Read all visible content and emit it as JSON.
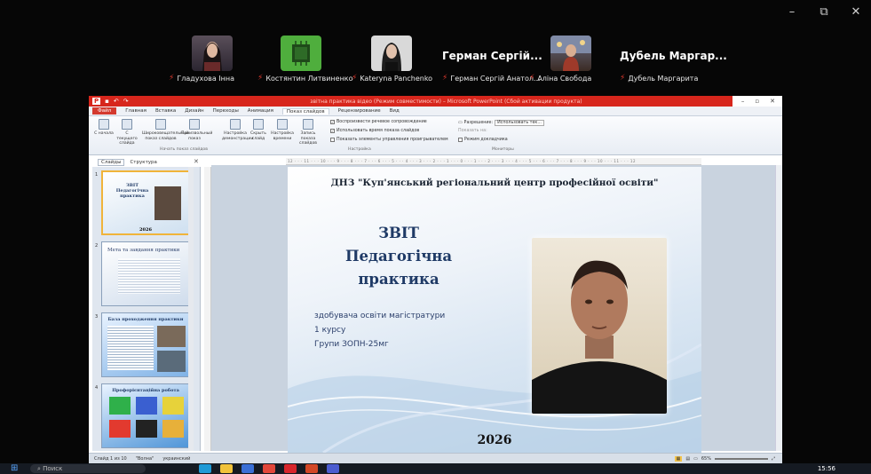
{
  "window_controls": {
    "minimize": "–",
    "restore": "⧉",
    "close": "✕"
  },
  "participants": [
    {
      "label": "Гладухова Інна",
      "thumb_color": "#3c3a45"
    },
    {
      "label": "Костянтин Литвиненко",
      "thumb_color": "#4fae3d"
    },
    {
      "label": "Kateryna Panchenko",
      "thumb_color": "#cdcdcd"
    },
    {
      "big_name": "Герман Сергій...",
      "label": "Герман Сергій Анатол..."
    },
    {
      "label": "Аліна Свобода",
      "thumb_color": "#8b5a3c"
    },
    {
      "big_name": "Дубель Маргар...",
      "label": "Дубель Маргарита"
    }
  ],
  "ppt": {
    "title": "звітна практика відео (Режим совместимости) – Microsoft PowerPoint (Сбой активации продукта)",
    "menu": [
      "Файл",
      "Главная",
      "Вставка",
      "Дизайн",
      "Переходы",
      "Анимация",
      "Показ слайдов",
      "Рецензирование",
      "Вид"
    ],
    "active_menu": "Показ слайдов",
    "ribbon_buttons": [
      "С начала",
      "С текущего слайда",
      "Широковещательный показ слайдов",
      "Произвольный показ",
      "Настройка демонстрации",
      "Скрыть слайд",
      "Настройка времени",
      "Запись показа слайдов"
    ],
    "ribbon_groups": [
      "Начать показ слайдов",
      "Настройка",
      "Мониторы"
    ],
    "checks": [
      "Воспроизвести речевое сопровождение",
      "Использовать время показа слайдов",
      "Показать элементы управления проигрывателем"
    ],
    "resolution_label": "Разрешение:",
    "resolution_value": "Использовать тек...",
    "show_on_label": "Показать на:",
    "presenter_view": "Режим докладчика",
    "pane_tabs": [
      "Слайды",
      "Структура"
    ],
    "ruler_text": "12 · · · 11 · · · 10 · · · 9 · · · 8 · · · 7 · · · 6 · · · 5 · · · 4 · · · 3 · · · 2 · · · 1 · · · 0 · · · 1 · · · 2 · · · 3 · · · 4 · · · 5 · · · 6 · · · 7 · · · 8 · · · 9 · · · 10 · · · 11 · · · 12",
    "thumbs": [
      {
        "num": "1",
        "title": "ЗВІТ Педагогічна практика",
        "year": "2026"
      },
      {
        "num": "2",
        "title": "Мета та завдання практики"
      },
      {
        "num": "3",
        "title": "База проходження практики"
      },
      {
        "num": "4",
        "title": "Профорієнтаційна робота"
      }
    ],
    "slide": {
      "header": "ДНЗ \"Куп'янський регіональний центр професійної освіти\"",
      "title_lines": [
        "ЗВІТ",
        "Педагогічна",
        "практика"
      ],
      "sub_lines": [
        "здобувача освіти магістратури",
        "1 курсу",
        "Групи ЗОПН-25мг"
      ],
      "year": "2026"
    },
    "status": {
      "slide_info": "Слайд 1 из 10",
      "theme": "\"Волна\"",
      "lang": "украинский",
      "zoom": "65%"
    }
  },
  "taskbar": {
    "search_placeholder": "Поиск",
    "time": "15:56"
  }
}
